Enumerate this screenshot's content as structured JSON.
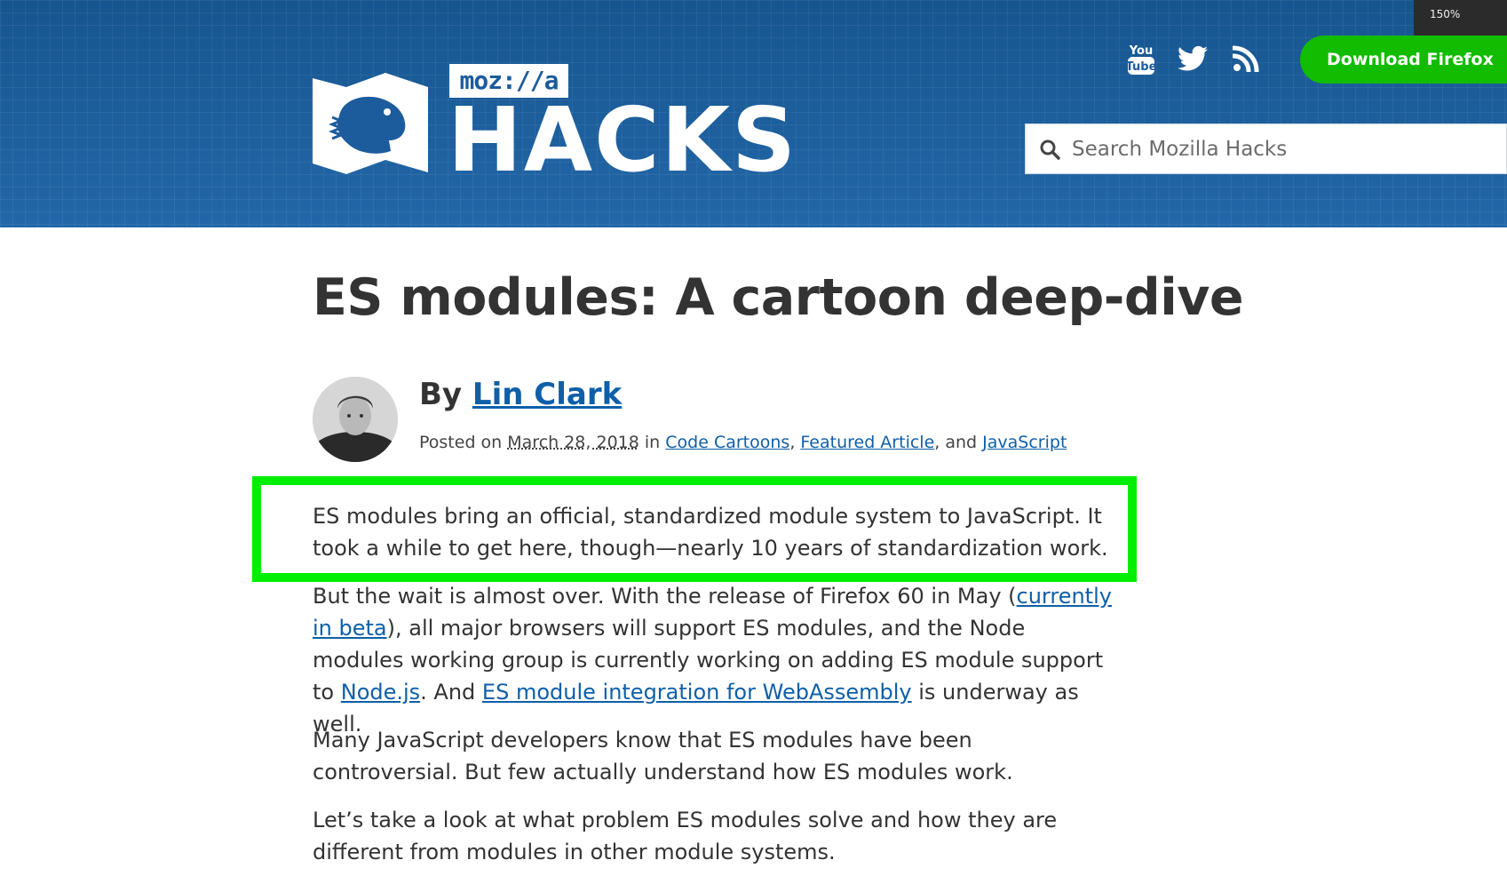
{
  "browser": {
    "zoom": "150%"
  },
  "header": {
    "logo": {
      "badge": "moz://a",
      "wordmark": "HACKS"
    },
    "social": [
      {
        "name": "YouTube",
        "icon": "youtube-icon"
      },
      {
        "name": "Twitter",
        "icon": "twitter-icon"
      },
      {
        "name": "RSS",
        "icon": "rss-icon"
      }
    ],
    "download_label": "Download Firefox",
    "search_placeholder": "Search Mozilla Hacks",
    "colors": {
      "header_bg": "#1d5c9c",
      "download_bg": "#12bc00"
    }
  },
  "article": {
    "title": "ES modules: A cartoon deep-dive",
    "byline_prefix": "By",
    "author": "Lin Clark",
    "posted_prefix": "Posted on",
    "date": "March 28, 2018",
    "in_label": "in",
    "categories": [
      "Code Cartoons",
      "Featured Article",
      "JavaScript"
    ],
    "and_label": "and",
    "paragraphs": {
      "p1": "ES modules bring an official, standardized module system to JavaScript. It took a while to get here, though—nearly 10 years of standardization work.",
      "p2_a": "But the wait is almost over. With the release of Firefox 60 in May (",
      "p2_link1": "currently in beta",
      "p2_b": "), all major browsers will support ES modules, and the Node modules working group is currently working on adding ES module support to ",
      "p2_link2": "Node.js",
      "p2_c": ". And ",
      "p2_link3": "ES module integration for WebAssembly",
      "p2_d": " is underway as well.",
      "p3": "Many JavaScript developers know that ES modules have been controversial. But few actually understand how ES modules work.",
      "p4": "Let’s take a look at what problem ES modules solve and how they are different from modules in other module systems."
    },
    "highlight_color": "#00ef00"
  }
}
